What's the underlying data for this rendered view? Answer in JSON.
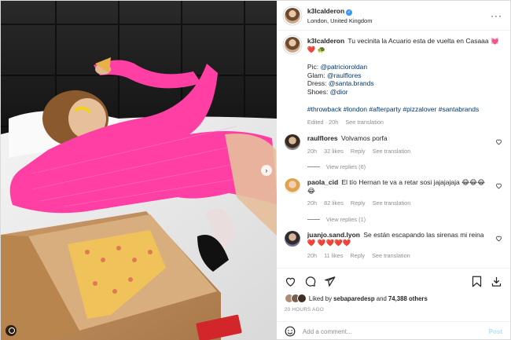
{
  "post": {
    "username": "k3lcalderon",
    "location": "London, United Kingdom",
    "caption_text": "Tu vecinita la Acuario esta de vuelta en Casaaa 💓",
    "caption_emoji": "❤️ 🐢",
    "credits": [
      {
        "label": "Pic:",
        "handle": "@patricioroldan"
      },
      {
        "label": "Glam:",
        "handle": "@raulflores"
      },
      {
        "label": "Dress:",
        "handle": "@santa.brands"
      },
      {
        "label": "Shoes:",
        "handle": "@dior"
      }
    ],
    "hashtags": "#throwback #london #afterparty #pizzalover #santabrands",
    "caption_meta": {
      "edited": "Edited · 20h",
      "see_translation": "See translation"
    }
  },
  "comments": [
    {
      "username": "raulflores",
      "text": "Volvamos porfa",
      "time": "20h",
      "likes": "32 likes",
      "reply": "Reply",
      "see_translation": "See translation",
      "view_replies": "View replies (6)"
    },
    {
      "username": "paola_cid",
      "text": "El tío Hernan te va a retar sosi jajajajaja 😂😂😂😂",
      "time": "20h",
      "likes": "82 likes",
      "reply": "Reply",
      "see_translation": "See translation",
      "view_replies": "View replies (1)"
    },
    {
      "username": "juanjo.sand.lyon",
      "text": "Se están escapando las sirenas mi reina ❤️ ❤️❤️❤️❤️",
      "time": "20h",
      "likes": "11 likes",
      "reply": "Reply",
      "see_translation": "See translation"
    }
  ],
  "likes": {
    "prefix": "Liked by",
    "user": "sebaparedesp",
    "joiner": "and",
    "count": "74,388 others"
  },
  "timestamp": "20 HOURS AGO",
  "composer": {
    "placeholder": "Add a comment...",
    "post_label": "Post"
  },
  "icons": {
    "like": "heart-icon",
    "comment": "comment-icon",
    "share": "share-icon",
    "save": "bookmark-icon",
    "download": "download-icon",
    "emoji": "smiley-icon",
    "more": "more-options-icon",
    "next": "chevron-right-icon",
    "tags": "user-tag-icon"
  },
  "colors": {
    "link": "#00376b",
    "secondary": "#8e8e8e",
    "verified": "#3897f0",
    "dress": "#ff3fa4",
    "post_disabled": "#b2dffc"
  }
}
